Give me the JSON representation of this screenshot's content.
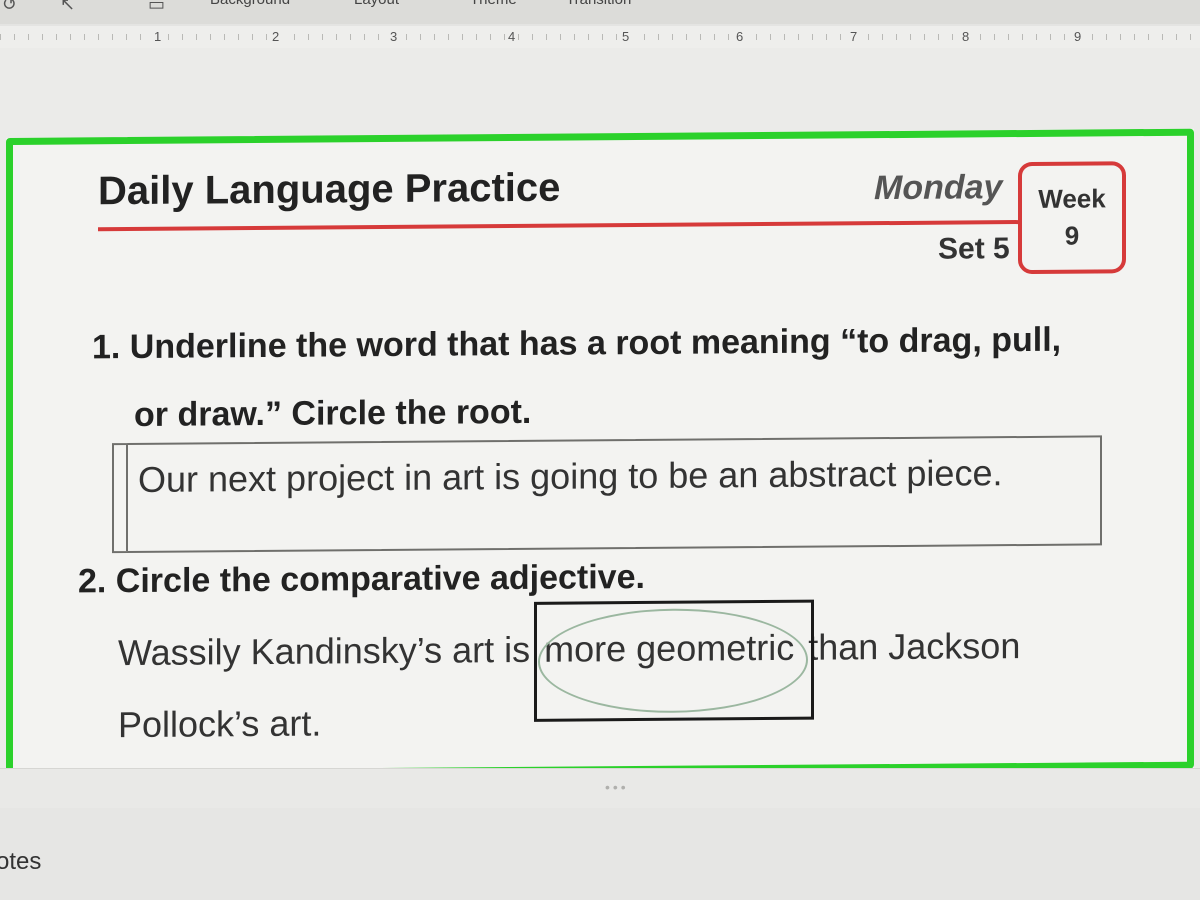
{
  "toolbar": {
    "items": [
      "Background",
      "Layout",
      "Theme",
      "Transition"
    ]
  },
  "ruler": {
    "marks": [
      "1",
      "2",
      "3",
      "4",
      "5",
      "6",
      "7",
      "8",
      "9"
    ]
  },
  "slide": {
    "title": "Daily Language Practice",
    "day": "Monday",
    "set": "Set 5",
    "week_label": "Week",
    "week_number": "9",
    "q1": {
      "line1": "1. Underline the word that has a root meaning “to drag, pull,",
      "line2": "or draw.” Circle the root.",
      "answer": "Our next project in art is going to be an abstract piece."
    },
    "q2": {
      "prompt": "2. Circle the comparative adjective.",
      "sentence_before": "Wassily Kandinsky’s art is ",
      "sentence_highlight": "more geometric",
      "sentence_after": " than Jackson Pollock’s art."
    }
  },
  "notes": {
    "label": "otes"
  },
  "colors": {
    "slide_border": "#2bd12b",
    "accent_red": "#d63a3a"
  }
}
